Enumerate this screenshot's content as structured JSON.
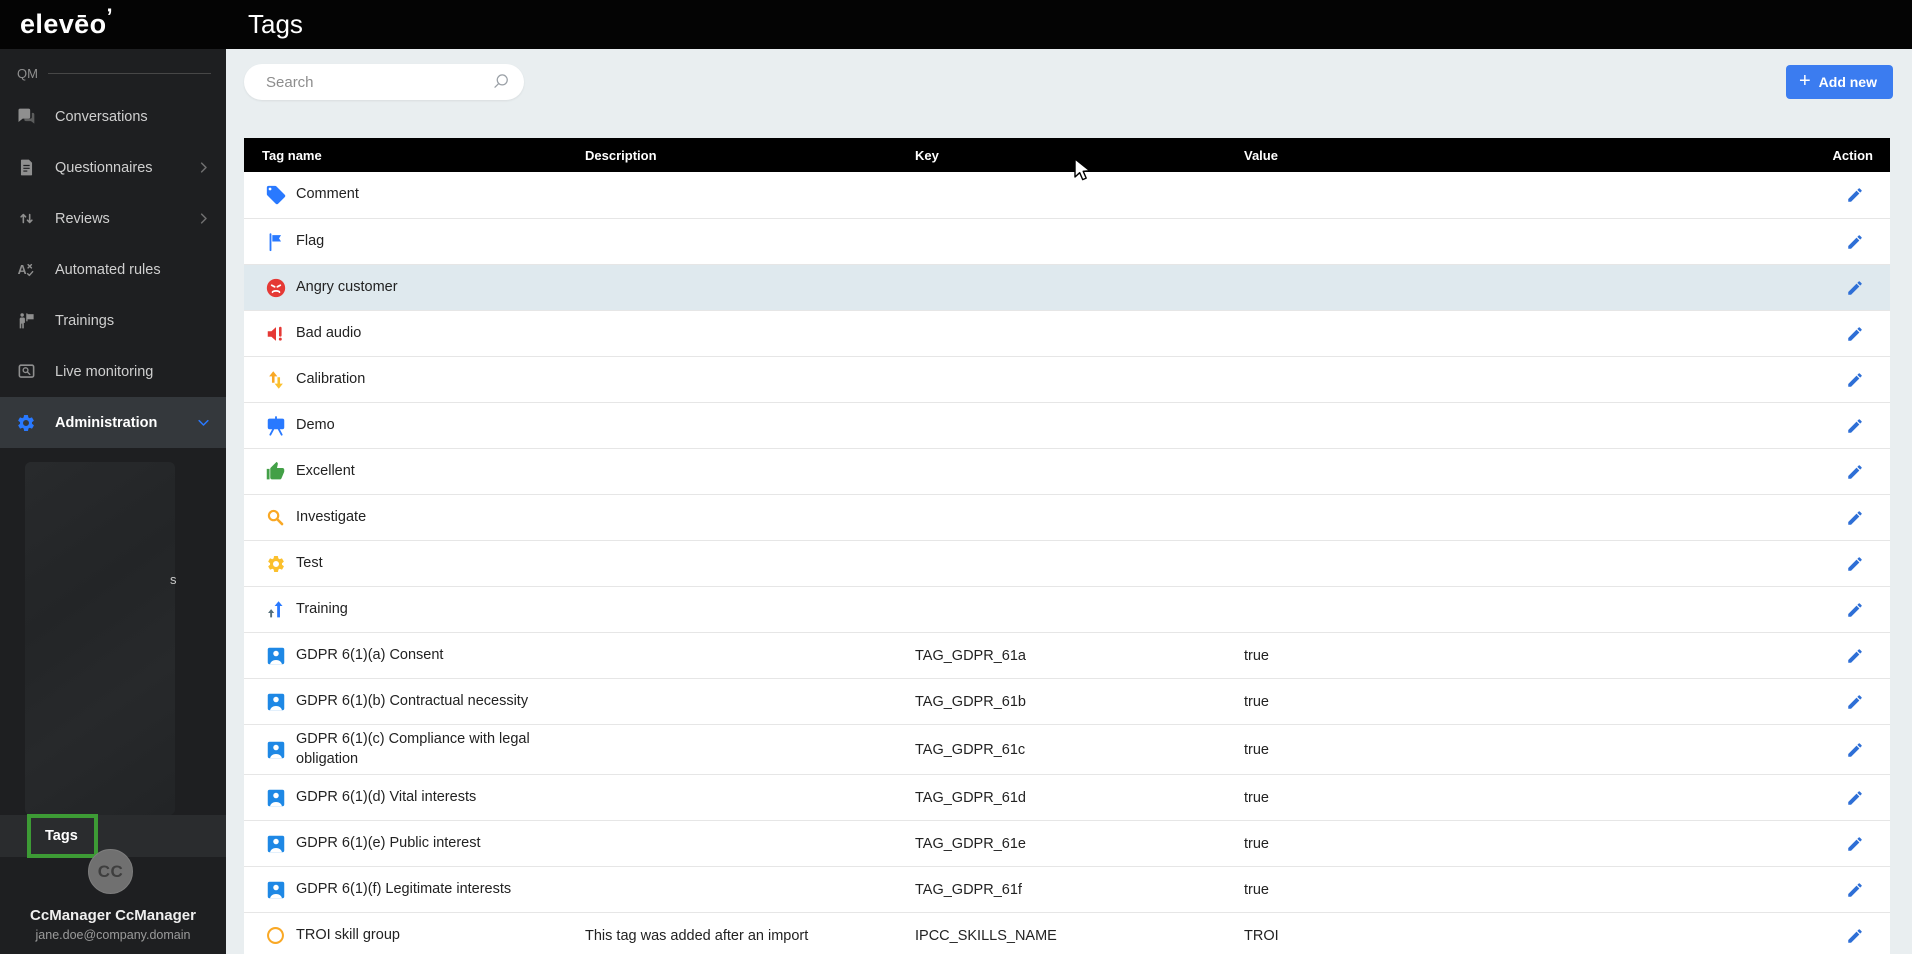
{
  "brand": {
    "logo": "elevēo",
    "logo_mark": "’",
    "section": "QM"
  },
  "header": {
    "title": "Tags"
  },
  "toolbar": {
    "search_placeholder": "Search",
    "add_button_label": "Add new",
    "plus_glyph": "+"
  },
  "sidebar": {
    "items": [
      {
        "label": "Conversations",
        "icon": "chat-icon"
      },
      {
        "label": "Questionnaires",
        "icon": "questionnaire-icon",
        "chevron": "right"
      },
      {
        "label": "Reviews",
        "icon": "sort-arrows-icon",
        "chevron": "right"
      },
      {
        "label": "Automated rules",
        "icon": "automated-rules-icon"
      },
      {
        "label": "Trainings",
        "icon": "trainings-icon"
      },
      {
        "label": "Live monitoring",
        "icon": "live-monitoring-icon"
      },
      {
        "label": "Administration",
        "icon": "gear-icon",
        "chevron": "down",
        "active": true
      }
    ],
    "redacted_hint": "s",
    "submenu_active": "Tags",
    "user": {
      "initials": "CC",
      "name": "CcManager CcManager",
      "email": "jane.doe@company.domain"
    }
  },
  "table": {
    "columns": [
      "Tag name",
      "Description",
      "Key",
      "Value",
      "Action"
    ],
    "rows": [
      {
        "name": "Comment",
        "icon": "tag-icon",
        "description": "",
        "key": "",
        "value": ""
      },
      {
        "name": "Flag",
        "icon": "flag-icon",
        "description": "",
        "key": "",
        "value": ""
      },
      {
        "name": "Angry customer",
        "icon": "angry-face-icon",
        "description": "",
        "key": "",
        "value": "",
        "highlighted": true
      },
      {
        "name": "Bad audio",
        "icon": "bad-audio-icon",
        "description": "",
        "key": "",
        "value": ""
      },
      {
        "name": "Calibration",
        "icon": "calibration-arrows-icon",
        "description": "",
        "key": "",
        "value": ""
      },
      {
        "name": "Demo",
        "icon": "presentation-icon",
        "description": "",
        "key": "",
        "value": ""
      },
      {
        "name": "Excellent",
        "icon": "thumbs-up-icon",
        "description": "",
        "key": "",
        "value": ""
      },
      {
        "name": "Investigate",
        "icon": "magnifier-icon",
        "description": "",
        "key": "",
        "value": ""
      },
      {
        "name": "Test",
        "icon": "test-gear-icon",
        "description": "",
        "key": "",
        "value": ""
      },
      {
        "name": "Training",
        "icon": "ascending-arrows-icon",
        "description": "",
        "key": "",
        "value": ""
      },
      {
        "name": "GDPR 6(1)(a) Consent",
        "icon": "person-badge-icon",
        "description": "",
        "key": "TAG_GDPR_61a",
        "value": "true"
      },
      {
        "name": "GDPR 6(1)(b) Contractual necessity",
        "icon": "person-badge-icon",
        "description": "",
        "key": "TAG_GDPR_61b",
        "value": "true"
      },
      {
        "name": "GDPR 6(1)(c) Compliance with legal obligation",
        "icon": "person-badge-icon",
        "description": "",
        "key": "TAG_GDPR_61c",
        "value": "true"
      },
      {
        "name": "GDPR 6(1)(d) Vital interests",
        "icon": "person-badge-icon",
        "description": "",
        "key": "TAG_GDPR_61d",
        "value": "true"
      },
      {
        "name": "GDPR 6(1)(e) Public interest",
        "icon": "person-badge-icon",
        "description": "",
        "key": "TAG_GDPR_61e",
        "value": "true"
      },
      {
        "name": "GDPR 6(1)(f) Legitimate interests",
        "icon": "person-badge-icon",
        "description": "",
        "key": "TAG_GDPR_61f",
        "value": "true"
      },
      {
        "name": "TROI skill group",
        "icon": "circle-outline-icon",
        "description": "This tag was added after an import",
        "key": "IPCC_SKILLS_NAME",
        "value": "TROI"
      }
    ],
    "row_action_icon": "edit-icon"
  },
  "colors": {
    "button_blue": "#3b7cf0",
    "accent_blue": "#2e6fd6",
    "tag_blue": "#2979ff",
    "person_blue": "#1e88e5",
    "alert_red": "#e53935",
    "amber": "#f9a825",
    "yellow": "#fbc02d",
    "green": "#43a047",
    "dark_arrow": "#546e7a",
    "green_annotation": "#3d9b35",
    "row_highlight": "#dfe9ee"
  }
}
